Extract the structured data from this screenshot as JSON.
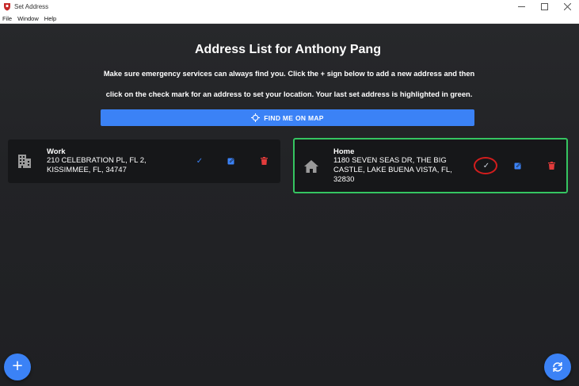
{
  "window": {
    "title": "Set Address"
  },
  "menu": [
    "File",
    "Window",
    "Help"
  ],
  "header": {
    "title": "Address List for Anthony Pang",
    "subtitle_line1": "Make sure emergency services can always find you. Click the + sign below to add a new address and then",
    "subtitle_line2": "click on the check mark for an address to set your location. Your last set address is highlighted in green."
  },
  "map_button": {
    "label": "FIND ME ON MAP"
  },
  "addresses": [
    {
      "name": "Work",
      "line1": "210 CELEBRATION PL, FL 2,",
      "line2": "KISSIMMEE, FL, 34747",
      "selected": false
    },
    {
      "name": "Home",
      "line1": "1180 SEVEN SEAS DR, THE BIG",
      "line2": "CASTLE, LAKE BUENA VISTA, FL,",
      "line3": "32830",
      "selected": true
    }
  ],
  "icons": {
    "work": "building-icon",
    "home": "house-icon",
    "set": "check-icon",
    "edit": "edit-icon",
    "delete": "trash-icon",
    "add": "plus-icon",
    "refresh": "refresh-icon"
  },
  "colors": {
    "accent": "#3b82f6",
    "selected_border": "#35c561",
    "delete": "#e23b3b",
    "highlight_ring": "#d31d1d"
  }
}
